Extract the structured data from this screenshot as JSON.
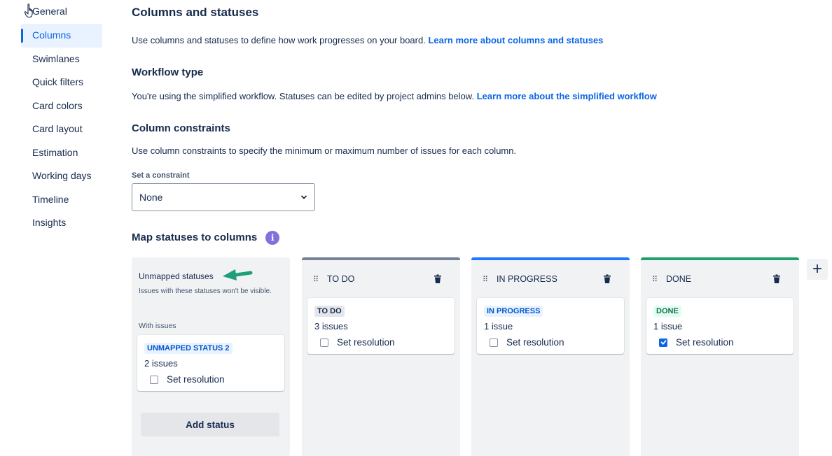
{
  "sidebar": {
    "items": [
      {
        "label": "General"
      },
      {
        "label": "Columns"
      },
      {
        "label": "Swimlanes"
      },
      {
        "label": "Quick filters"
      },
      {
        "label": "Card colors"
      },
      {
        "label": "Card layout"
      },
      {
        "label": "Estimation"
      },
      {
        "label": "Working days"
      },
      {
        "label": "Timeline"
      },
      {
        "label": "Insights"
      }
    ],
    "active": "Columns"
  },
  "main": {
    "title": "Columns and statuses",
    "intro": "Use columns and statuses to define how work progresses on your board.",
    "intro_link": "Learn more about columns and statuses",
    "workflow_heading": "Workflow type",
    "workflow_text": "You're using the simplified workflow. Statuses can be edited by project admins below.",
    "workflow_link": "Learn more about the simplified workflow",
    "constraints_heading": "Column constraints",
    "constraints_text": "Use column constraints to specify the minimum or maximum number of issues for each column.",
    "constraint_label": "Set a constraint",
    "constraint_value": "None",
    "map_heading": "Map statuses to columns",
    "info_glyph": "i"
  },
  "board": {
    "unmapped": {
      "title": "Unmapped statuses",
      "description": "Issues with these statuses won't be visible.",
      "with_issues": "With issues",
      "card": {
        "status": "UNMAPPED STATUS 2",
        "issues": "2 issues",
        "resolution_label": "Set resolution",
        "checked": false
      },
      "add_status": "Add status"
    },
    "columns": [
      {
        "name": "TO DO",
        "bar_color": "#758195",
        "card": {
          "status": "TO DO",
          "issues": "3 issues",
          "resolution_label": "Set resolution",
          "checked": false
        }
      },
      {
        "name": "IN PROGRESS",
        "bar_color": "#1d7afc",
        "card": {
          "status": "IN PROGRESS",
          "issues": "1 issue",
          "resolution_label": "Set resolution",
          "checked": false
        }
      },
      {
        "name": "DONE",
        "bar_color": "#22a06b",
        "card": {
          "status": "DONE",
          "issues": "1 issue",
          "resolution_label": "Set resolution",
          "checked": true
        }
      }
    ],
    "add_column_glyph": "+"
  },
  "colors": {
    "accent": "#0c66e4",
    "arrow": "#1f9e7a",
    "info": "#8270db"
  }
}
